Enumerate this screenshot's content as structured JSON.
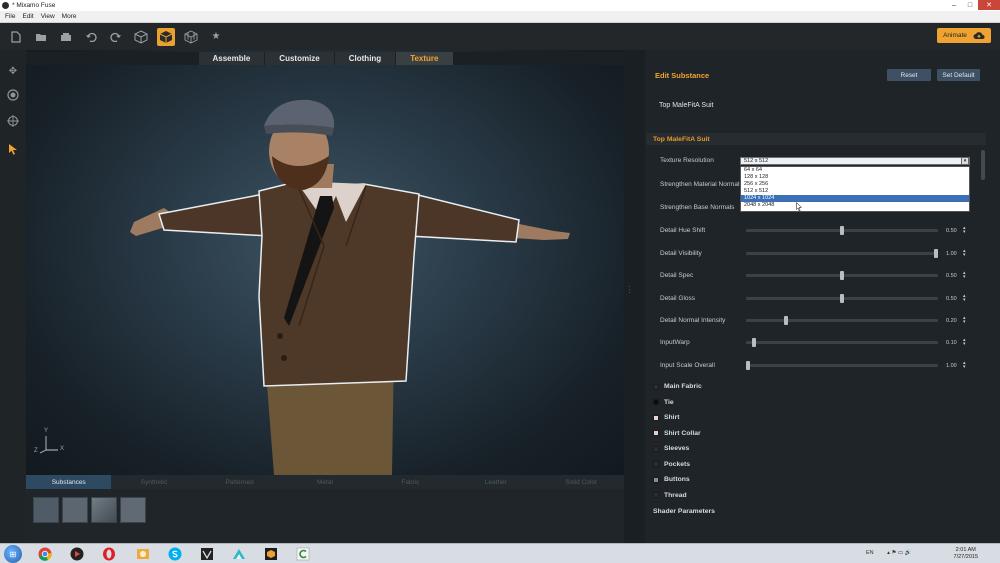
{
  "window": {
    "title": "* Mixamo Fuse",
    "minimize": "–",
    "maximize": "□",
    "close": "✕"
  },
  "menu": [
    "File",
    "Edit",
    "View",
    "More"
  ],
  "toolbar": {
    "icons": [
      "new-file-icon",
      "open-folder-icon",
      "save-icon",
      "undo-icon",
      "redo-icon",
      "box-outline-icon",
      "box-active-icon",
      "box-grid-icon",
      "star-icon"
    ],
    "animate_label": "Animate"
  },
  "viewport": {
    "tabs": [
      {
        "label": "Assemble"
      },
      {
        "label": "Customize"
      },
      {
        "label": "Clothing"
      },
      {
        "label": "Texture",
        "active": true
      }
    ],
    "axis_labels": {
      "y": "Y",
      "z": "Z",
      "x": "X"
    },
    "bottom_tabs": [
      {
        "label": "Substances",
        "active": true
      },
      {
        "label": "Synthetic"
      },
      {
        "label": "Patterned"
      },
      {
        "label": "Metal"
      },
      {
        "label": "Fabric"
      },
      {
        "label": "Leather"
      },
      {
        "label": "Solid Color"
      }
    ],
    "swatch_count": 4
  },
  "panel": {
    "header": "Edit Substance",
    "reset_label": "Reset",
    "set_default_label": "Set Default",
    "substance_name": "Top MaleFitA Suit",
    "section_title": "Top MaleFitA Suit",
    "texture_resolution": {
      "label": "Texture Resolution",
      "value": "512 x 512",
      "options": [
        "64 x 64",
        "128 x 128",
        "256 x 256",
        "512 x 512",
        "1024 x 1024",
        "2048 x 2048"
      ],
      "highlighted": "1024 x 1024"
    },
    "checkbox_params": [
      {
        "label": "Strengthen Material Normals"
      },
      {
        "label": "Strengthen Base Normals"
      }
    ],
    "params": [
      {
        "label": "Detail Hue Shift",
        "value": "0.50",
        "fraction": 0.5
      },
      {
        "label": "Detail Visibility",
        "value": "1.00",
        "fraction": 1.0
      },
      {
        "label": "Detail Spec",
        "value": "0.50",
        "fraction": 0.5
      },
      {
        "label": "Detail Gloss",
        "value": "0.50",
        "fraction": 0.5
      },
      {
        "label": "Detail Normal Intensity",
        "value": "0.20",
        "fraction": 0.2
      },
      {
        "label": "InputWarp",
        "value": "0.10",
        "fraction": 0.03
      },
      {
        "label": "Input Scale Overall",
        "value": "1.00",
        "fraction": 0.0
      }
    ],
    "materials": [
      {
        "label": "Main Fabric",
        "color": "#2b2f33"
      },
      {
        "label": "Tie",
        "color": "#0c0c0c"
      },
      {
        "label": "Shirt",
        "color": "#e9d2cc"
      },
      {
        "label": "Shirt Collar",
        "color": "#e7cfc9"
      },
      {
        "label": "Sleeves",
        "color": "#2b2f33"
      },
      {
        "label": "Pockets",
        "color": "#2b2f33"
      },
      {
        "label": "Buttons",
        "color": "#8c8c8c"
      },
      {
        "label": "Thread",
        "color": "#2b2f33"
      }
    ],
    "shader_label": "Shader Parameters"
  },
  "taskbar": {
    "apps": [
      "chrome-icon",
      "media-player-icon",
      "opera-icon",
      "photo-viewer-icon",
      "skype-icon",
      "vectorworks-icon",
      "mixamo-icon",
      "cube-app-icon",
      "c-app-icon"
    ],
    "language": "EN",
    "time": "2:01 AM",
    "date": "7/27/2015"
  }
}
